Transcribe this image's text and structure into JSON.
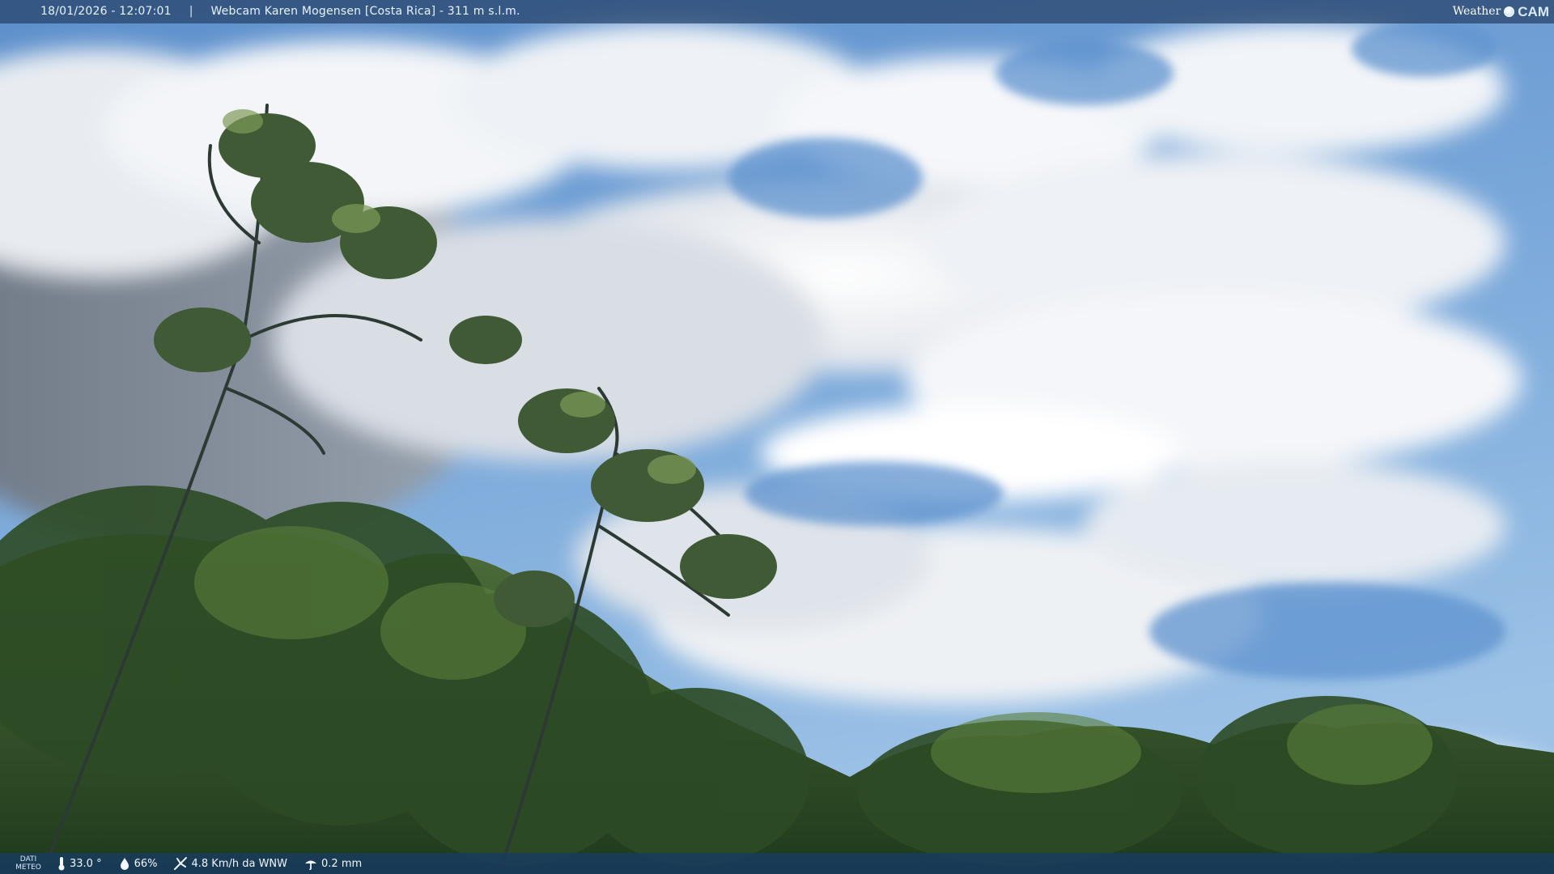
{
  "header": {
    "datetime": "18/01/2026 - 12:07:01",
    "separator": "|",
    "title": "Webcam Karen Mogensen [Costa Rica] - 311 m s.l.m."
  },
  "logo": {
    "weather": "Weather",
    "cam": "CAM"
  },
  "footer": {
    "label_line1": "DATI",
    "label_line2": "METEO",
    "temperature": "33.0 °",
    "humidity": "66%",
    "wind": "4.8 Km/h da WNW",
    "rain": "0.2 mm"
  },
  "icons": {
    "temperature": "thermometer-icon",
    "humidity": "droplet-icon",
    "wind": "wind-vane-icon",
    "rain": "rain-gauge-icon"
  },
  "colors": {
    "sky": "#6f9fd3",
    "cloud": "#f4f6f9",
    "foliage": "#2b4a24",
    "bar": "#264168"
  }
}
